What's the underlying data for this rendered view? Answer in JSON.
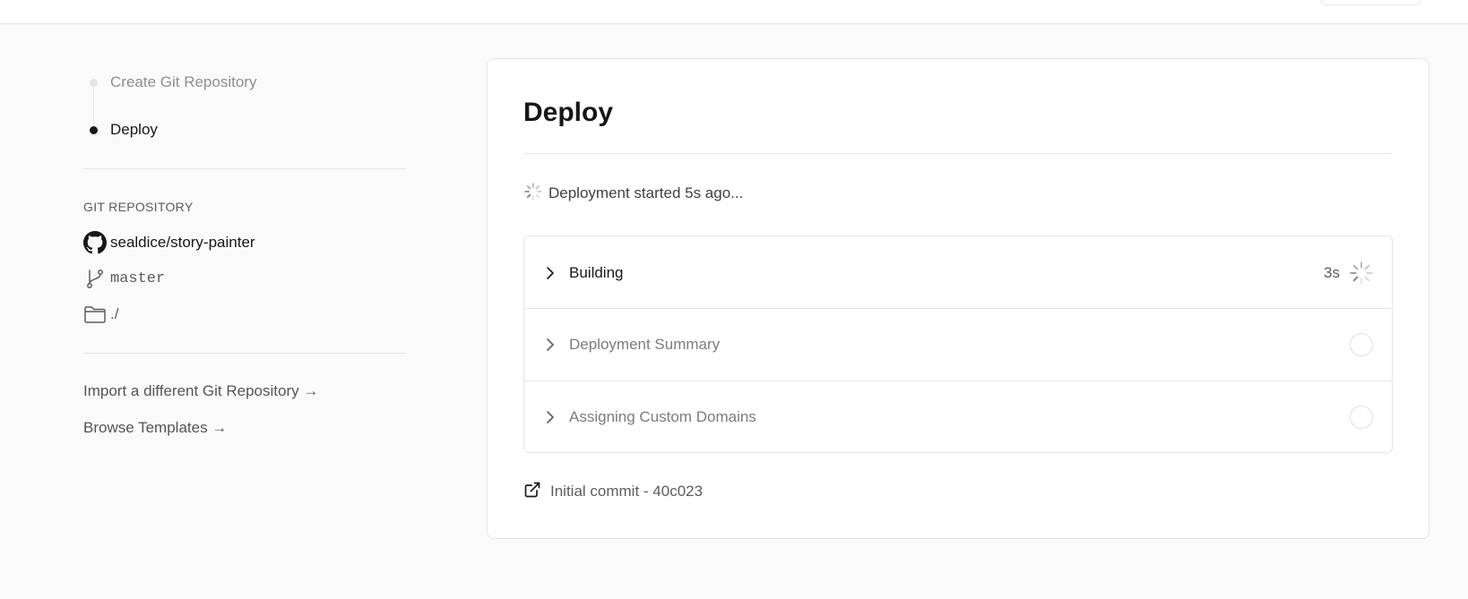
{
  "steps": [
    {
      "label": "Create Git Repository",
      "state": "done"
    },
    {
      "label": "Deploy",
      "state": "active"
    }
  ],
  "git": {
    "section_title": "GIT REPOSITORY",
    "repo": "sealdice/story-painter",
    "branch": "master",
    "root_dir": "./"
  },
  "links": {
    "import": "Import a different Git Repository →",
    "browse": "Browse Templates →"
  },
  "main": {
    "title": "Deploy",
    "status": "Deployment started 5s ago...",
    "rows": [
      {
        "label": "Building",
        "time": "3s",
        "status": "in-progress"
      },
      {
        "label": "Deployment Summary",
        "time": "",
        "status": "pending"
      },
      {
        "label": "Assigning Custom Domains",
        "time": "",
        "status": "pending"
      }
    ],
    "commit": "Initial commit - 40c023"
  },
  "icons": {
    "repo": "github-icon",
    "branch": "git-branch-icon",
    "dir": "folder-icon",
    "chevron": "chevron-right-icon",
    "spinner": "spinner-icon",
    "external": "external-link-icon"
  },
  "colors": {
    "text_primary": "#171717",
    "text_muted": "#8f8f8f",
    "border": "#e5e5e5",
    "background": "#fafafa"
  }
}
